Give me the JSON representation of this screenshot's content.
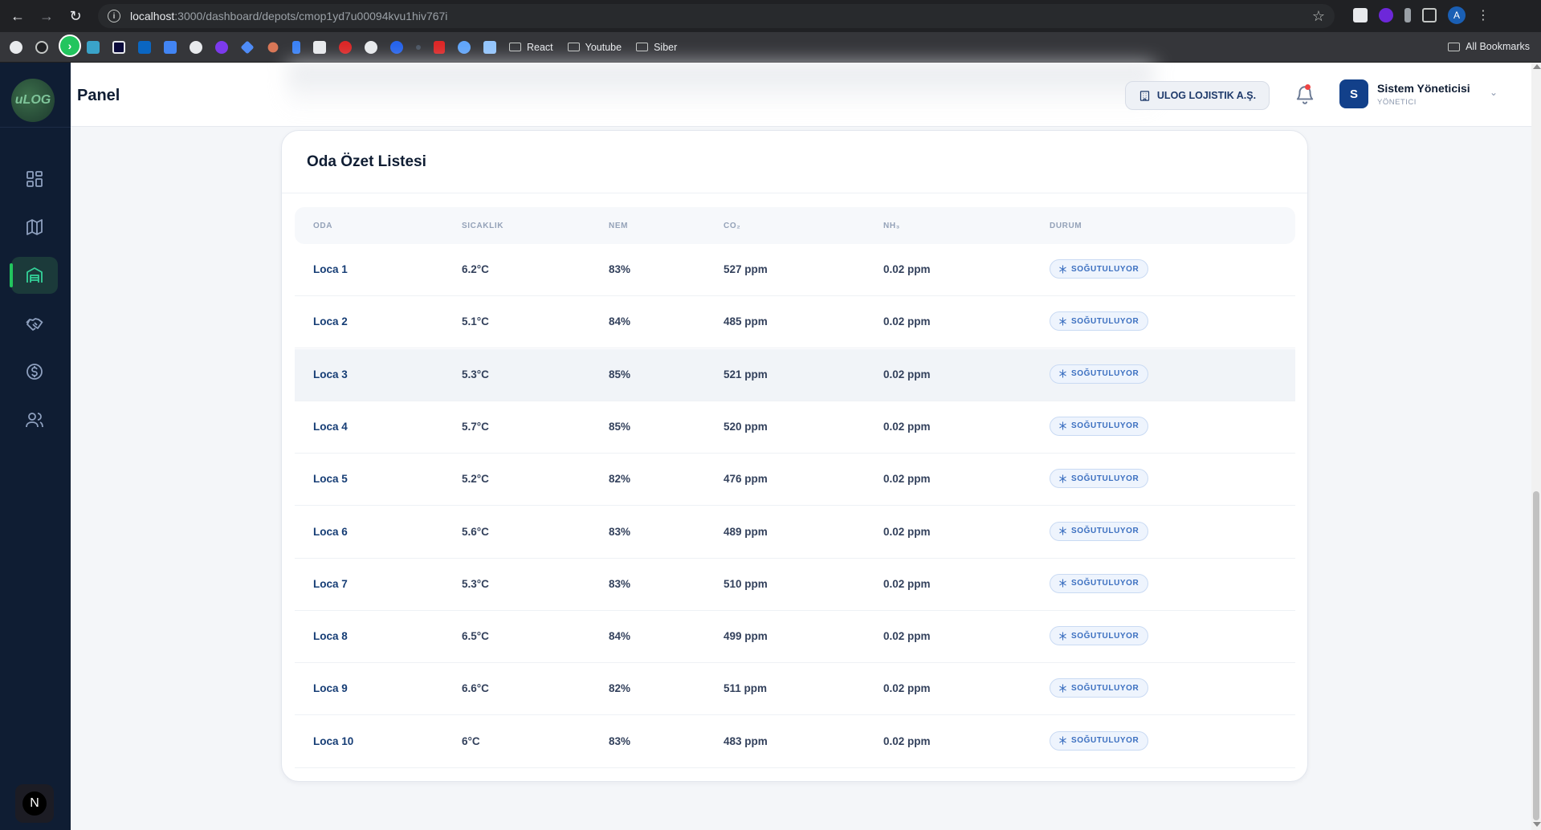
{
  "browser": {
    "url_host": "localhost",
    "url_path": ":3000/dashboard/depots/cmop1yd7u00094kvu1hiv767i",
    "profile_initial": "A",
    "bookmarks": [
      "React",
      "Youtube",
      "Siber"
    ],
    "all_bookmarks": "All Bookmarks"
  },
  "sidebar": {
    "logo_text": "uLOG",
    "items": [
      {
        "icon": "dashboard-grid-icon"
      },
      {
        "icon": "map-icon"
      },
      {
        "icon": "warehouse-icon"
      },
      {
        "icon": "handshake-icon"
      },
      {
        "icon": "dollar-circle-icon"
      },
      {
        "icon": "users-icon"
      }
    ],
    "active_index": 2,
    "footer_badge": "N"
  },
  "header": {
    "title": "Panel",
    "company": "ULOG LOJISTIK A.Ş.",
    "user_initial": "S",
    "user_name": "Sistem Yöneticisi",
    "user_role": "YÖNETICI"
  },
  "card": {
    "title": "Oda Özet Listesi",
    "columns": [
      "ODA",
      "SICAKLIK",
      "NEM",
      "CO₂",
      "NH₃",
      "DURUM"
    ],
    "rows": [
      {
        "oda": "Loca 1",
        "sicaklik": "6.2°C",
        "nem": "83%",
        "co2": "527 ppm",
        "nh3": "0.02 ppm",
        "durum": "SOĞUTULUYOR"
      },
      {
        "oda": "Loca 2",
        "sicaklik": "5.1°C",
        "nem": "84%",
        "co2": "485 ppm",
        "nh3": "0.02 ppm",
        "durum": "SOĞUTULUYOR"
      },
      {
        "oda": "Loca 3",
        "sicaklik": "5.3°C",
        "nem": "85%",
        "co2": "521 ppm",
        "nh3": "0.02 ppm",
        "durum": "SOĞUTULUYOR"
      },
      {
        "oda": "Loca 4",
        "sicaklik": "5.7°C",
        "nem": "85%",
        "co2": "520 ppm",
        "nh3": "0.02 ppm",
        "durum": "SOĞUTULUYOR"
      },
      {
        "oda": "Loca 5",
        "sicaklik": "5.2°C",
        "nem": "82%",
        "co2": "476 ppm",
        "nh3": "0.02 ppm",
        "durum": "SOĞUTULUYOR"
      },
      {
        "oda": "Loca 6",
        "sicaklik": "5.6°C",
        "nem": "83%",
        "co2": "489 ppm",
        "nh3": "0.02 ppm",
        "durum": "SOĞUTULUYOR"
      },
      {
        "oda": "Loca 7",
        "sicaklik": "5.3°C",
        "nem": "83%",
        "co2": "510 ppm",
        "nh3": "0.02 ppm",
        "durum": "SOĞUTULUYOR"
      },
      {
        "oda": "Loca 8",
        "sicaklik": "6.5°C",
        "nem": "84%",
        "co2": "499 ppm",
        "nh3": "0.02 ppm",
        "durum": "SOĞUTULUYOR"
      },
      {
        "oda": "Loca 9",
        "sicaklik": "6.6°C",
        "nem": "82%",
        "co2": "511 ppm",
        "nh3": "0.02 ppm",
        "durum": "SOĞUTULUYOR"
      },
      {
        "oda": "Loca 10",
        "sicaklik": "6°C",
        "nem": "83%",
        "co2": "483 ppm",
        "nh3": "0.02 ppm",
        "durum": "SOĞUTULUYOR"
      }
    ],
    "highlighted_row": 2
  },
  "colors": {
    "sidebar_bg": "#0f1d33",
    "accent_green": "#22c55e",
    "status_blue": "#3b6fc0",
    "room_link": "#163d75"
  }
}
